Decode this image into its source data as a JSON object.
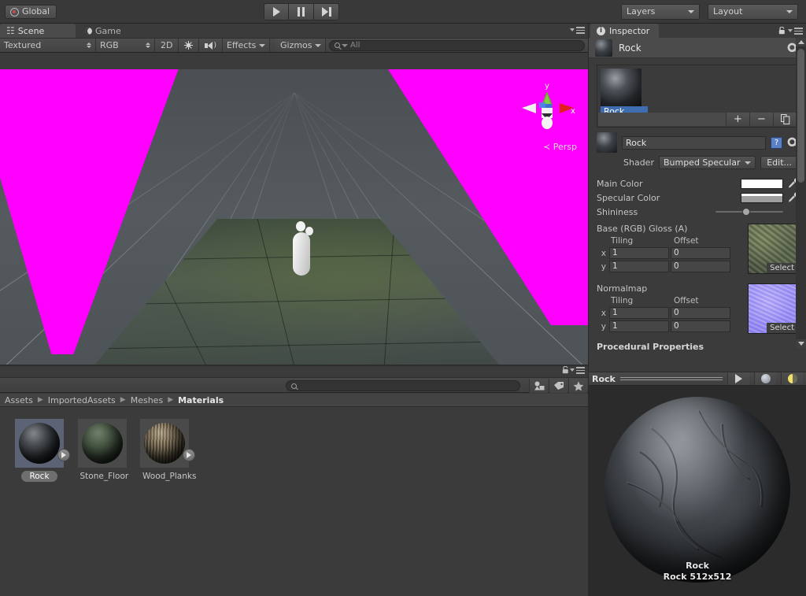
{
  "toolbar": {
    "global_label": "Global",
    "play_icon": "play-icon",
    "pause_icon": "pause-icon",
    "step_icon": "step-icon",
    "layers_label": "Layers",
    "layout_label": "Layout"
  },
  "scene_panel": {
    "tabs": [
      {
        "label": "Scene",
        "icon": "grid-hash-icon",
        "active": true
      },
      {
        "label": "Game",
        "icon": "moon-icon",
        "active": false
      }
    ],
    "toolbar": {
      "draw_mode": "Textured",
      "render_mode": "RGB",
      "view_2d": "2D",
      "lighting_icon": "sun-icon",
      "audio_icon": "speaker-icon",
      "effects_label": "Effects",
      "gizmos_label": "Gizmos",
      "search_placeholder": "All",
      "search_value": ""
    },
    "gizmo": {
      "axis_x": "x",
      "axis_y": "y",
      "projection_label": "Persp",
      "back_arrow": "≺"
    }
  },
  "project_panel": {
    "search_value": "",
    "filter_icons": [
      "object-filter-icon",
      "label-filter-icon",
      "favorite-filter-icon"
    ],
    "breadcrumb": [
      "Assets",
      "ImportedAssets",
      "Meshes",
      "Materials"
    ],
    "assets": [
      {
        "name": "Rock",
        "selected": true,
        "has_expand": true
      },
      {
        "name": "Stone_Floor",
        "selected": false,
        "has_expand": false
      },
      {
        "name": "Wood_Planks",
        "selected": false,
        "has_expand": true
      }
    ]
  },
  "inspector": {
    "tab_label": "Inspector",
    "lock_icon": "lock-icon",
    "menu_icon": "hamburger-menu-icon",
    "header_title": "Rock",
    "gear_icon": "gear-icon",
    "material_list": {
      "selected_item": "Rock",
      "add_label": "+",
      "remove_label": "−",
      "duplicate_icon": "copy-icon"
    },
    "material": {
      "name": "Rock",
      "help_icon": "help-book-icon",
      "gear_icon": "gear-icon",
      "shader_label": "Shader",
      "shader_value": "Bumped Specular",
      "edit_label": "Edit..."
    },
    "properties": [
      {
        "label": "Main Color",
        "type": "color",
        "value": "#ffffff"
      },
      {
        "label": "Specular Color",
        "type": "color",
        "value": "#a0a0a0"
      },
      {
        "label": "Shininess",
        "type": "slider",
        "value": 40
      }
    ],
    "textures": [
      {
        "title": "Base (RGB) Gloss (A)",
        "tiling_header": "Tiling",
        "offset_header": "Offset",
        "rows": [
          {
            "axis": "x",
            "tiling": "1",
            "offset": "0"
          },
          {
            "axis": "y",
            "tiling": "1",
            "offset": "0"
          }
        ],
        "select_label": "Select",
        "preview": "rock-albedo-texture"
      },
      {
        "title": "Normalmap",
        "tiling_header": "Tiling",
        "offset_header": "Offset",
        "rows": [
          {
            "axis": "x",
            "tiling": "1",
            "offset": "0"
          },
          {
            "axis": "y",
            "tiling": "1",
            "offset": "0"
          }
        ],
        "select_label": "Select",
        "preview": "rock-normalmap-texture"
      }
    ],
    "procedural_header": "Procedural Properties"
  },
  "preview": {
    "title": "Rock",
    "play_icon": "play-icon",
    "sphere_icon": "preview-sphere-icon",
    "light_icon": "preview-lighting-icon",
    "label_name": "Rock",
    "label_detail": "Rock   512x512"
  },
  "colors": {
    "chrome": "#3b3b3b",
    "panel": "#4b4b4b",
    "selection_blue": "#3e6db0",
    "magenta": "#FF00FF",
    "axis_x": "#e02020",
    "axis_y": "#6abf2a",
    "axis_z": "#2a6ad0"
  }
}
